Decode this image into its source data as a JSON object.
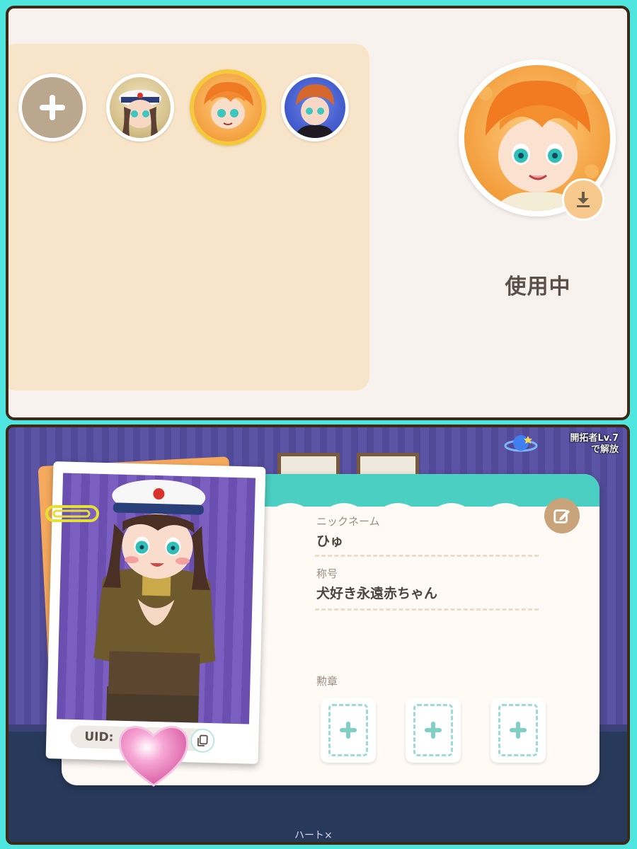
{
  "top": {
    "add_label": "+",
    "status_label": "使用中"
  },
  "bottom": {
    "unlock_note_line1": "開拓者Lv.7",
    "unlock_note_line2": "で解放",
    "nickname_label": "ニックネーム",
    "nickname_value": "ひゅ",
    "title_label": "称号",
    "title_value": "犬好き永遠赤ちゃん",
    "badges_label": "勲章",
    "uid_label": "UID:",
    "badge_slots": [
      "+",
      "+",
      "+"
    ],
    "bottom_text": "ハート×"
  },
  "colors": {
    "tray": "#f8e4c8",
    "selected_ring": "#f6c83e",
    "card_header": "#4bcfc3",
    "edit_button": "#c9a37a",
    "frame_border": "#3c2a17"
  },
  "icons": [
    "plus-icon",
    "download-icon",
    "edit-icon",
    "copy-icon",
    "heart-icon",
    "paper-clip-icon",
    "planet-icon"
  ]
}
